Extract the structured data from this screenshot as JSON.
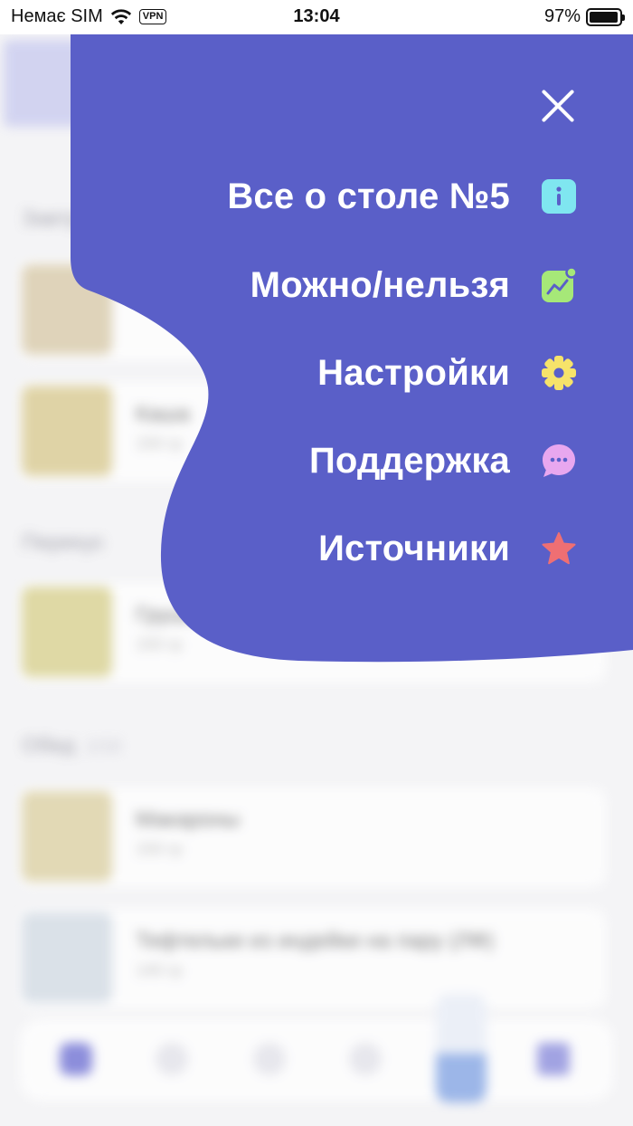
{
  "status_bar": {
    "carrier": "Немає SIM",
    "vpn": "VPN",
    "time": "13:04",
    "battery": "97%",
    "battery_level": 0.97
  },
  "background": {
    "sections": [
      {
        "title": "Завтрак"
      },
      {
        "title": "Перекус"
      },
      {
        "title": "Обед",
        "count": "1/10"
      }
    ],
    "cards": [
      {
        "title": "",
        "subtitle": ""
      },
      {
        "title": "Каша",
        "subtitle": "150 гр"
      },
      {
        "title": "Груша",
        "subtitle": "150 гр"
      },
      {
        "title": "Макароны",
        "subtitle": "150 гр"
      },
      {
        "title": "Тефтельки из индейки на пару (ЛФ)",
        "subtitle": "140 гр"
      }
    ]
  },
  "menu": {
    "color": "#5a5fc8",
    "items": [
      {
        "label": "Все о столе №5",
        "icon": "info-icon",
        "icon_color": "#7fe6f0"
      },
      {
        "label": "Можно/нельзя",
        "icon": "chart-icon",
        "icon_color": "#a6e878"
      },
      {
        "label": "Настройки",
        "icon": "gear-icon",
        "icon_color": "#f6e36a"
      },
      {
        "label": "Поддержка",
        "icon": "chat-icon",
        "icon_color": "#e8a7ef"
      },
      {
        "label": "Источники",
        "icon": "star-icon",
        "icon_color": "#ef6f73"
      }
    ]
  }
}
